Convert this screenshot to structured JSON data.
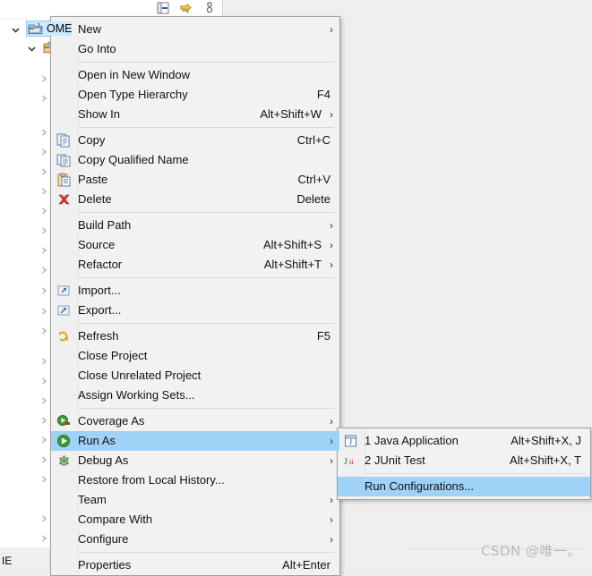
{
  "window": {
    "background_color": "#eeeeee",
    "panel_background": "#ffffff"
  },
  "toolbar": {
    "items": [
      {
        "name": "collapse-all-icon",
        "tooltip": "Collapse All"
      },
      {
        "name": "link-with-editor-icon",
        "tooltip": "Link with Editor"
      },
      {
        "name": "view-menu-icon",
        "tooltip": "View Menu"
      }
    ]
  },
  "tree": {
    "rows": [
      {
        "label": "OME",
        "expanded": true,
        "selected": true,
        "icon": "java-project-icon",
        "indent": 14
      },
      {
        "label": "",
        "expanded": true,
        "selected": false,
        "icon": "source-folder-icon",
        "indent": 32
      },
      {
        "label": "",
        "expanded": false,
        "selected": false,
        "icon": "",
        "indent": 50
      },
      {
        "label": "",
        "expanded": false,
        "selected": false,
        "icon": "",
        "indent": 50
      }
    ],
    "collapsed_markers": 18,
    "bottom_label": "IE",
    "scrollbar": {
      "left_arrow": "‹",
      "thumb_visible": true
    }
  },
  "context_menu": {
    "highlight_color": "#9fd2f7",
    "items": [
      {
        "type": "item",
        "label": "New",
        "accel": "",
        "submenu": true,
        "icon": ""
      },
      {
        "type": "item",
        "label": "Go Into",
        "accel": "",
        "submenu": false,
        "icon": ""
      },
      {
        "type": "separator"
      },
      {
        "type": "item",
        "label": "Open in New Window",
        "accel": "",
        "submenu": false,
        "icon": ""
      },
      {
        "type": "item",
        "label": "Open Type Hierarchy",
        "accel": "F4",
        "submenu": false,
        "icon": ""
      },
      {
        "type": "item",
        "label": "Show In",
        "accel": "Alt+Shift+W",
        "submenu": true,
        "icon": ""
      },
      {
        "type": "separator"
      },
      {
        "type": "item",
        "label": "Copy",
        "accel": "Ctrl+C",
        "submenu": false,
        "icon": "copy-icon"
      },
      {
        "type": "item",
        "label": "Copy Qualified Name",
        "accel": "",
        "submenu": false,
        "icon": "copy-qualified-name-icon"
      },
      {
        "type": "item",
        "label": "Paste",
        "accel": "Ctrl+V",
        "submenu": false,
        "icon": "paste-icon"
      },
      {
        "type": "item",
        "label": "Delete",
        "accel": "Delete",
        "submenu": false,
        "icon": "delete-icon"
      },
      {
        "type": "separator"
      },
      {
        "type": "item",
        "label": "Build Path",
        "accel": "",
        "submenu": true,
        "icon": ""
      },
      {
        "type": "item",
        "label": "Source",
        "accel": "Alt+Shift+S",
        "submenu": true,
        "icon": ""
      },
      {
        "type": "item",
        "label": "Refactor",
        "accel": "Alt+Shift+T",
        "submenu": true,
        "icon": ""
      },
      {
        "type": "separator"
      },
      {
        "type": "item",
        "label": "Import...",
        "accel": "",
        "submenu": false,
        "icon": "import-icon"
      },
      {
        "type": "item",
        "label": "Export...",
        "accel": "",
        "submenu": false,
        "icon": "export-icon"
      },
      {
        "type": "separator"
      },
      {
        "type": "item",
        "label": "Refresh",
        "accel": "F5",
        "submenu": false,
        "icon": "refresh-icon"
      },
      {
        "type": "item",
        "label": "Close Project",
        "accel": "",
        "submenu": false,
        "icon": ""
      },
      {
        "type": "item",
        "label": "Close Unrelated Project",
        "accel": "",
        "submenu": false,
        "icon": ""
      },
      {
        "type": "item",
        "label": "Assign Working Sets...",
        "accel": "",
        "submenu": false,
        "icon": ""
      },
      {
        "type": "separator"
      },
      {
        "type": "item",
        "label": "Coverage As",
        "accel": "",
        "submenu": true,
        "icon": "coverage-as-icon"
      },
      {
        "type": "item",
        "label": "Run As",
        "accel": "",
        "submenu": true,
        "icon": "run-as-icon",
        "highlighted": true
      },
      {
        "type": "item",
        "label": "Debug As",
        "accel": "",
        "submenu": true,
        "icon": "debug-as-icon"
      },
      {
        "type": "item",
        "label": "Restore from Local History...",
        "accel": "",
        "submenu": false,
        "icon": ""
      },
      {
        "type": "item",
        "label": "Team",
        "accel": "",
        "submenu": true,
        "icon": ""
      },
      {
        "type": "item",
        "label": "Compare With",
        "accel": "",
        "submenu": true,
        "icon": ""
      },
      {
        "type": "item",
        "label": "Configure",
        "accel": "",
        "submenu": true,
        "icon": ""
      },
      {
        "type": "separator"
      },
      {
        "type": "item",
        "label": "Properties",
        "accel": "Alt+Enter",
        "submenu": false,
        "icon": ""
      }
    ]
  },
  "submenu": {
    "parent": "Run As",
    "highlight_color": "#9fd2f7",
    "items": [
      {
        "type": "item",
        "label": "1 Java Application",
        "accel": "Alt+Shift+X, J",
        "icon": "java-application-icon"
      },
      {
        "type": "item",
        "label": "2 JUnit Test",
        "accel": "Alt+Shift+X, T",
        "icon": "junit-icon"
      },
      {
        "type": "separator"
      },
      {
        "type": "item",
        "label": "Run Configurations...",
        "accel": "",
        "icon": "",
        "highlighted": true
      }
    ]
  },
  "watermark": {
    "text": "CSDN @唯一。"
  }
}
